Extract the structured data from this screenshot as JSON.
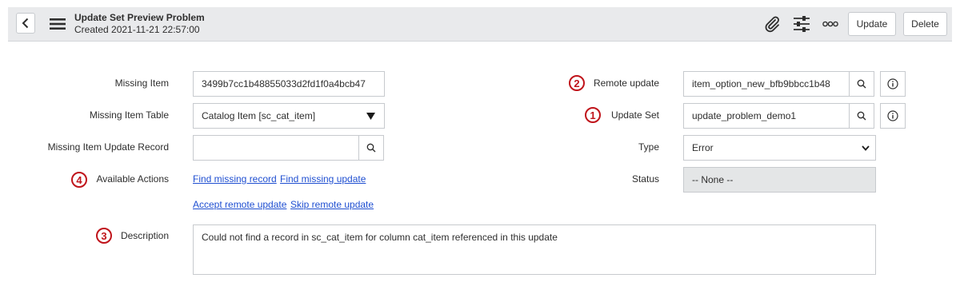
{
  "header": {
    "title": "Update Set Preview Problem",
    "created": "Created 2021-11-21 22:57:00",
    "update_label": "Update",
    "delete_label": "Delete"
  },
  "form": {
    "missing_item": {
      "label": "Missing Item",
      "value": "3499b7cc1b48855033d2fd1f0a4bcb47"
    },
    "missing_item_table": {
      "label": "Missing Item Table",
      "value": "Catalog Item [sc_cat_item]"
    },
    "missing_item_update_record": {
      "label": "Missing Item Update Record",
      "value": ""
    },
    "available_actions": {
      "label": "Available Actions",
      "links": [
        "Find missing record",
        "Find missing update",
        "Accept remote update",
        "Skip remote update"
      ]
    },
    "description": {
      "label": "Description",
      "value": "Could not find a record in sc_cat_item for column cat_item referenced in this update"
    },
    "remote_update": {
      "label": "Remote update",
      "value": "item_option_new_bfb9bbcc1b48"
    },
    "update_set": {
      "label": "Update Set",
      "value": "update_problem_demo1"
    },
    "type": {
      "label": "Type",
      "value": "Error"
    },
    "status": {
      "label": "Status",
      "value": "-- None --"
    }
  },
  "annotations": [
    "1",
    "2",
    "3",
    "4"
  ],
  "colors": {
    "annotation": "#c0141b",
    "link": "#1f4fd1",
    "header_bg": "#e9eaec"
  }
}
